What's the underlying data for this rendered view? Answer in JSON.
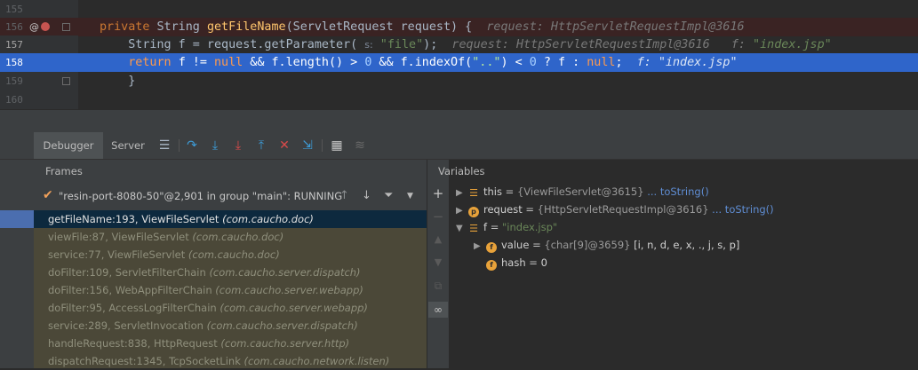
{
  "editor": {
    "lines": [
      {
        "num": "155"
      },
      {
        "num": "156",
        "code": {
          "kw": "private ",
          "type": "String ",
          "fn": "getFileName",
          "rest": "(ServletRequest request) {  ",
          "hint": "request: HttpServletRequestImpl@3616"
        }
      },
      {
        "num": "157",
        "code": {
          "pre": "    String f = request.getParameter( ",
          "ph": "s:",
          "str": " \"file\"",
          "rest": ");  ",
          "hint1": "request: HttpServletRequestImpl@3616",
          "hint2": "f: ",
          "hint2v": "\"index.jsp\""
        }
      },
      {
        "num": "158",
        "code": {
          "kw": "    return ",
          "a": "f != ",
          "null1": "null",
          "b": " && f.length() > ",
          "n0": "0",
          "c": " && f.indexOf(",
          "dots": "\"..\"",
          "d": ") < ",
          "n1": "0",
          "e": " ? f : ",
          "null2": "null",
          "f": ";  ",
          "hint": "f: ",
          "hintv": "\"index.jsp\""
        }
      },
      {
        "num": "159",
        "code": {
          "brace": "    }"
        }
      },
      {
        "num": "160"
      }
    ]
  },
  "debug": {
    "tabs": [
      "Debugger",
      "Server"
    ],
    "frames_header": "Frames",
    "variables_header": "Variables",
    "thread": "\"resin-port-8080-50\"@2,901 in group \"main\": RUNNING",
    "frames": [
      {
        "method": "getFileName:193, ViewFileServlet",
        "pkg": "(com.caucho.doc)"
      },
      {
        "method": "viewFile:87, ViewFileServlet",
        "pkg": "(com.caucho.doc)"
      },
      {
        "method": "service:77, ViewFileServlet",
        "pkg": "(com.caucho.doc)"
      },
      {
        "method": "doFilter:109, ServletFilterChain",
        "pkg": "(com.caucho.server.dispatch)"
      },
      {
        "method": "doFilter:156, WebAppFilterChain",
        "pkg": "(com.caucho.server.webapp)"
      },
      {
        "method": "doFilter:95, AccessLogFilterChain",
        "pkg": "(com.caucho.server.webapp)"
      },
      {
        "method": "service:289, ServletInvocation",
        "pkg": "(com.caucho.server.dispatch)"
      },
      {
        "method": "handleRequest:838, HttpRequest",
        "pkg": "(com.caucho.server.http)"
      },
      {
        "method": "dispatchRequest:1345, TcpSocketLink",
        "pkg": "(com.caucho.network.listen)"
      }
    ],
    "variables": [
      {
        "name": "this",
        "eq": " = ",
        "val": "{ViewFileServlet@3615}",
        "link": " ... toString()"
      },
      {
        "name": "request",
        "eq": " = ",
        "val": "{HttpServletRequestImpl@3616}",
        "link": " ... toString()"
      },
      {
        "name": "f",
        "eq": " = ",
        "str": "\"index.jsp\""
      },
      {
        "name": "value",
        "eq": " = ",
        "val": "{char[9]@3659} ",
        "str": "[i, n, d, e, x, ., j, s, p]"
      },
      {
        "name": "hash",
        "eq": " = ",
        "str": "0"
      }
    ]
  },
  "colors": {
    "accent": "#4b6eaf",
    "selected_line": "#2f65ca",
    "breakpoint_line": "#3a2323",
    "frames_bg": "#4b4838"
  }
}
